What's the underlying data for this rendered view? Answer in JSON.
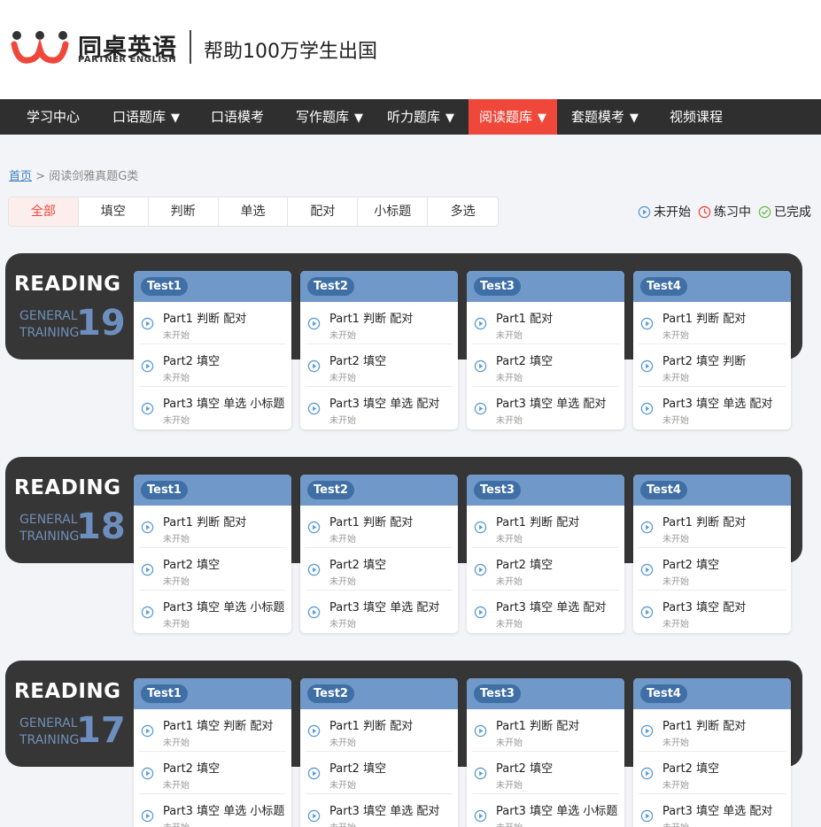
{
  "brand": {
    "name_cn": "同桌英语",
    "name_en": "PARTNER ENGLISH",
    "slogan": "帮助100万学生出国",
    "colors": {
      "primary": "#f0473b",
      "nav_bg": "#2f2f2f",
      "card_head": "#7098c9",
      "band": "#363636"
    }
  },
  "nav": [
    {
      "label": "学习中心",
      "dropdown": false,
      "active": false
    },
    {
      "label": "口语题库",
      "dropdown": true,
      "active": false
    },
    {
      "label": "口语模考",
      "dropdown": false,
      "active": false
    },
    {
      "label": "写作题库",
      "dropdown": true,
      "active": false
    },
    {
      "label": "听力题库",
      "dropdown": true,
      "active": false
    },
    {
      "label": "阅读题库",
      "dropdown": true,
      "active": true
    },
    {
      "label": "套题模考",
      "dropdown": true,
      "active": false
    },
    {
      "label": "视频课程",
      "dropdown": false,
      "active": false
    }
  ],
  "nav_arrow": "▼",
  "breadcrumb": {
    "home": "首页",
    "separator": ">",
    "current": "阅读剑雅真题G类"
  },
  "filters": [
    "全部",
    "填空",
    "判断",
    "单选",
    "配对",
    "小标题",
    "多选"
  ],
  "active_filter": "全部",
  "legend": [
    {
      "icon": "play-circle-icon",
      "label": "未开始"
    },
    {
      "icon": "clock-icon",
      "label": "练习中"
    },
    {
      "icon": "check-circle-icon",
      "label": "已完成"
    }
  ],
  "sections": [
    {
      "title": "READING",
      "line1": "GENERAL",
      "line2": "TRAINING",
      "number": "19",
      "tests": [
        {
          "name": "Test1",
          "parts": [
            {
              "title": "Part1 判断 配对",
              "status": "未开始"
            },
            {
              "title": "Part2 填空",
              "status": "未开始"
            },
            {
              "title": "Part3 填空 单选 小标题",
              "status": "未开始"
            }
          ]
        },
        {
          "name": "Test2",
          "parts": [
            {
              "title": "Part1 判断 配对",
              "status": "未开始"
            },
            {
              "title": "Part2 填空",
              "status": "未开始"
            },
            {
              "title": "Part3 填空 单选 配对",
              "status": "未开始"
            }
          ]
        },
        {
          "name": "Test3",
          "parts": [
            {
              "title": "Part1 配对",
              "status": "未开始"
            },
            {
              "title": "Part2 填空",
              "status": "未开始"
            },
            {
              "title": "Part3 填空 单选 配对",
              "status": "未开始"
            }
          ]
        },
        {
          "name": "Test4",
          "parts": [
            {
              "title": "Part1 判断 配对",
              "status": "未开始"
            },
            {
              "title": "Part2 填空 判断",
              "status": "未开始"
            },
            {
              "title": "Part3 填空 单选 配对",
              "status": "未开始"
            }
          ]
        }
      ]
    },
    {
      "title": "READING",
      "line1": "GENERAL",
      "line2": "TRAINING",
      "number": "18",
      "tests": [
        {
          "name": "Test1",
          "parts": [
            {
              "title": "Part1 判断 配对",
              "status": "未开始"
            },
            {
              "title": "Part2 填空",
              "status": "未开始"
            },
            {
              "title": "Part3 填空 单选 小标题",
              "status": "未开始"
            }
          ]
        },
        {
          "name": "Test2",
          "parts": [
            {
              "title": "Part1 判断 配对",
              "status": "未开始"
            },
            {
              "title": "Part2 填空",
              "status": "未开始"
            },
            {
              "title": "Part3 填空 单选 配对",
              "status": "未开始"
            }
          ]
        },
        {
          "name": "Test3",
          "parts": [
            {
              "title": "Part1 判断 配对",
              "status": "未开始"
            },
            {
              "title": "Part2 填空",
              "status": "未开始"
            },
            {
              "title": "Part3 填空 单选 配对",
              "status": "未开始"
            }
          ]
        },
        {
          "name": "Test4",
          "parts": [
            {
              "title": "Part1 判断 配对",
              "status": "未开始"
            },
            {
              "title": "Part2 填空",
              "status": "未开始"
            },
            {
              "title": "Part3 填空 配对",
              "status": "未开始"
            }
          ]
        }
      ]
    },
    {
      "title": "READING",
      "line1": "GENERAL",
      "line2": "TRAINING",
      "number": "17",
      "tests": [
        {
          "name": "Test1",
          "parts": [
            {
              "title": "Part1 填空 判断 配对",
              "status": "未开始"
            },
            {
              "title": "Part2 填空",
              "status": "未开始"
            },
            {
              "title": "Part3 填空 单选 小标题",
              "status": "未开始"
            }
          ]
        },
        {
          "name": "Test2",
          "parts": [
            {
              "title": "Part1 判断 配对",
              "status": "未开始"
            },
            {
              "title": "Part2 填空",
              "status": "未开始"
            },
            {
              "title": "Part3 填空 单选 配对",
              "status": "未开始"
            }
          ]
        },
        {
          "name": "Test3",
          "parts": [
            {
              "title": "Part1 判断 配对",
              "status": "未开始"
            },
            {
              "title": "Part2 填空",
              "status": "未开始"
            },
            {
              "title": "Part3 填空 单选 小标题",
              "status": "未开始"
            }
          ]
        },
        {
          "name": "Test4",
          "parts": [
            {
              "title": "Part1 判断 配对",
              "status": "未开始"
            },
            {
              "title": "Part2 填空",
              "status": "未开始"
            },
            {
              "title": "Part3 填空 单选 配对",
              "status": "未开始"
            }
          ]
        }
      ]
    }
  ]
}
